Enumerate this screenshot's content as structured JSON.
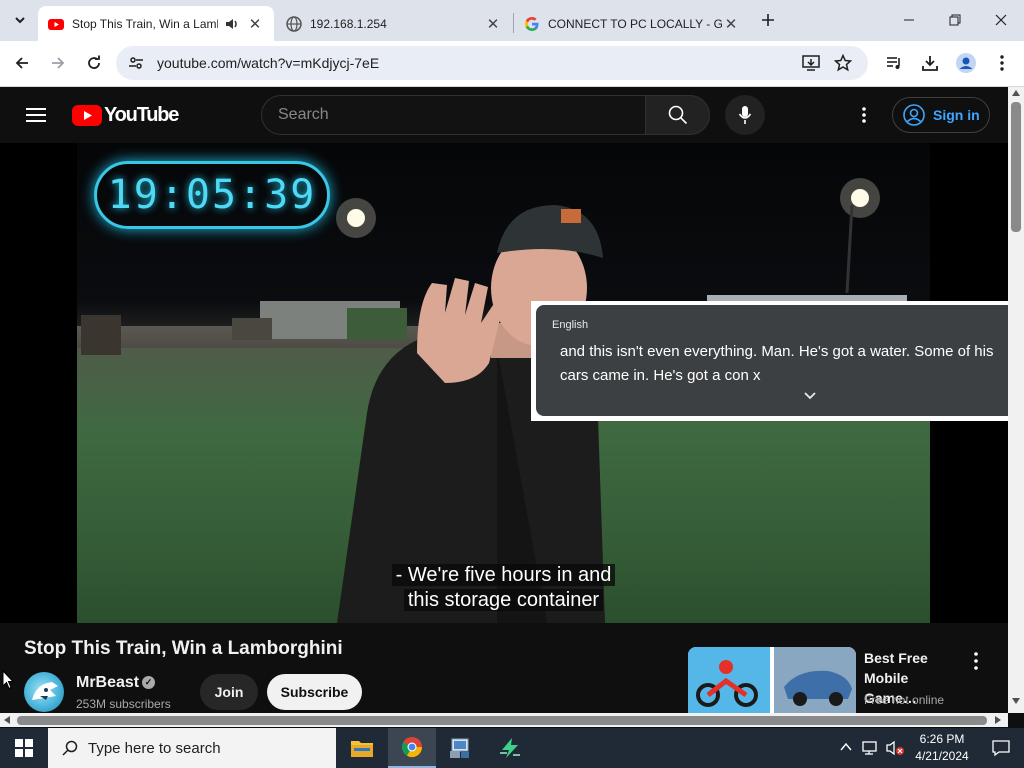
{
  "browser": {
    "tabs": [
      {
        "title": "Stop This Train, Win a Lamb",
        "favicon": "youtube-icon",
        "audio": true,
        "active": true
      },
      {
        "title": "192.168.1.254",
        "favicon": "globe-icon",
        "active": false
      },
      {
        "title": "CONNECT TO PC LOCALLY - Go",
        "favicon": "google-icon",
        "active": false
      }
    ],
    "url": "youtube.com/watch?v=mKdjycj-7eE"
  },
  "youtube": {
    "logo_text": "YouTube",
    "search_placeholder": "Search",
    "signin_label": "Sign in"
  },
  "video": {
    "clock_text": "19:05:39",
    "subtitle_line1": "- We're five hours in and",
    "subtitle_line2": "this storage container"
  },
  "live_caption": {
    "language": "English",
    "text_line1": "and this isn't even everything. Man. He's got a water. Some of his",
    "text_line2": "cars came in. He's got a con x"
  },
  "info": {
    "title": "Stop This Train, Win a Lamborghini",
    "channel": "MrBeast",
    "subscribers": "253M subscribers",
    "join_label": "Join",
    "subscribe_label": "Subscribe"
  },
  "ad": {
    "title": "Best Free Mobile Game…",
    "subtitle": "Free hot online"
  },
  "taskbar": {
    "search_placeholder": "Type here to search",
    "time": "6:26 PM",
    "date": "4/21/2024"
  }
}
